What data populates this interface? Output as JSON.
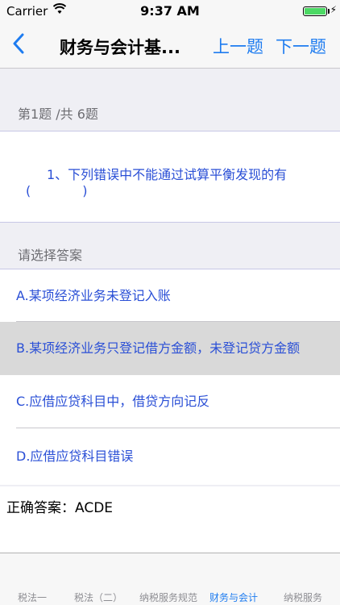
{
  "status_bar": {
    "carrier": "Carrier",
    "time": "9:37 AM"
  },
  "nav": {
    "title": "财务与会计基...",
    "prev_label": "上一题",
    "next_label": "下一题"
  },
  "question": {
    "counter": "第1题 /共 6题",
    "text": "1、下列错误中不能通过试算平衡发现的有(　　　　)"
  },
  "answer_section": {
    "header": "请选择答案",
    "options": [
      {
        "label": "A.某项经济业务未登记入账",
        "selected": false
      },
      {
        "label": "B.某项经济业务只登记借方金额，未登记贷方金额",
        "selected": true
      },
      {
        "label": "C.应借应贷科目中，借贷方向记反",
        "selected": false
      },
      {
        "label": "D.应借应贷科目错误",
        "selected": false
      }
    ]
  },
  "correct_answer": "正确答案：ACDE",
  "tab_bar": {
    "tabs": [
      {
        "label": "税法一",
        "active": false
      },
      {
        "label": "税法（二）",
        "active": false
      },
      {
        "label": "纳税服务规范",
        "active": false
      },
      {
        "label": "财务与会计",
        "active": true
      },
      {
        "label": "纳税服务",
        "active": false
      }
    ]
  },
  "colors": {
    "accent": "#1e7cf0",
    "option_text": "#2a4fd6",
    "selected_bg": "#d9d9d9",
    "battery": "#4cd964"
  },
  "icons": [
    "wifi-icon",
    "battery-icon",
    "charging-bolt-icon",
    "back-chevron-icon"
  ]
}
